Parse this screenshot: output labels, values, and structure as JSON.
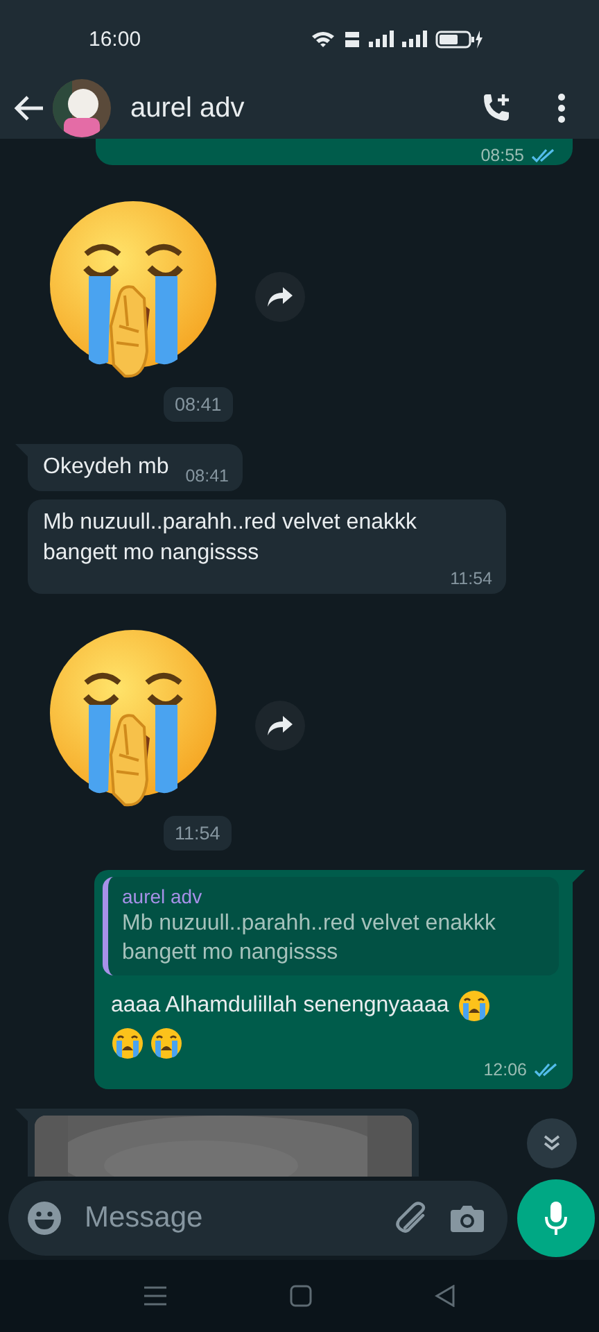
{
  "status_bar": {
    "time": "16:00"
  },
  "header": {
    "title": "aurel adv"
  },
  "messages": [
    {
      "kind": "outgoing_cut",
      "time": "08:55",
      "read": true
    },
    {
      "kind": "sticker",
      "time": "08:41"
    },
    {
      "kind": "incoming",
      "text": "Okeydeh mb",
      "time": "08:41",
      "tail": true
    },
    {
      "kind": "incoming",
      "text": "Mb nuzuull..parahh..red velvet enakkk bangett mo nangissss",
      "time": "11:54",
      "tail": false
    },
    {
      "kind": "sticker",
      "time": "11:54"
    },
    {
      "kind": "outgoing_reply",
      "quote_author": "aurel adv",
      "quote_text": "Mb nuzuull..parahh..red velvet enakkk bangett mo nangissss",
      "parts": [
        {
          "kind": "text",
          "text": "aaaa Alhamdulillah senengnyaaaa"
        },
        {
          "kind": "emoji"
        },
        {
          "kind": "emoji"
        },
        {
          "kind": "emoji"
        }
      ],
      "time": "12:06",
      "read": true,
      "tail": true
    },
    {
      "kind": "incoming_image",
      "tail": true
    }
  ],
  "composer": {
    "placeholder": "Message"
  }
}
